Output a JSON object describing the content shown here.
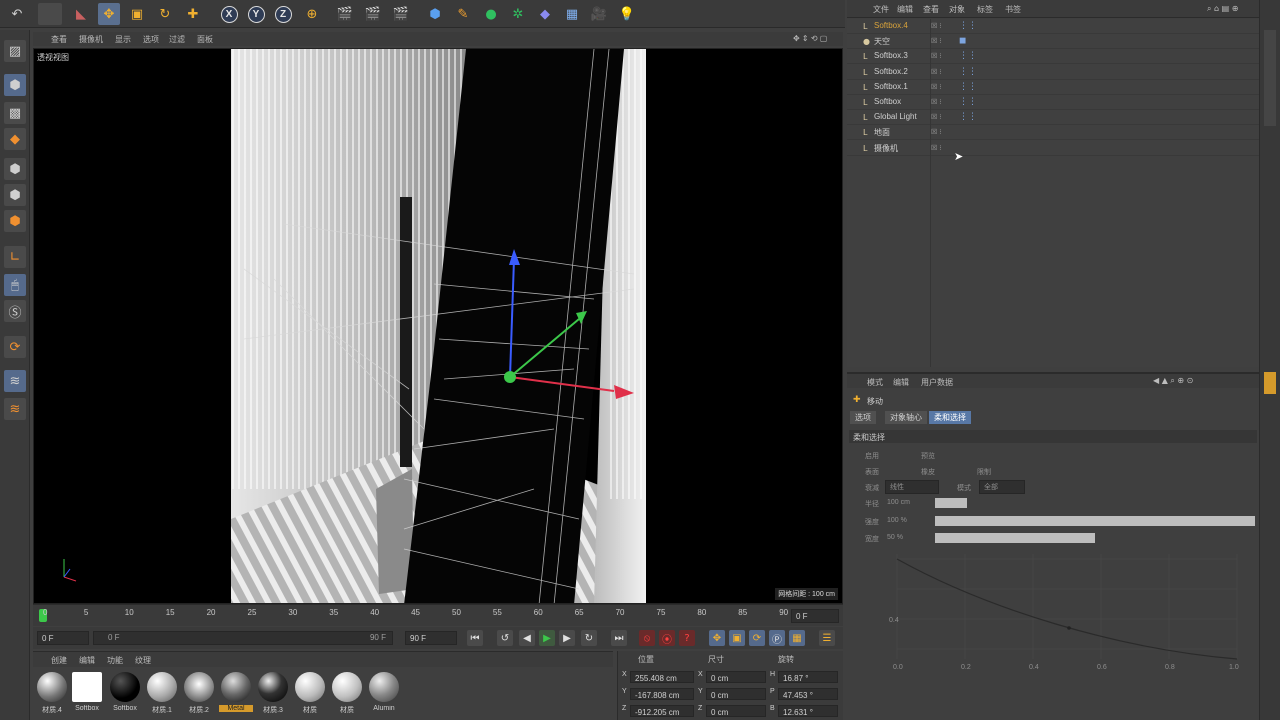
{
  "colors": {
    "accent": "#d9a33b",
    "selection": "#5878a6",
    "axis_x": "#e0304a",
    "axis_y": "#3cc84a",
    "axis_z": "#3a5cff"
  },
  "toolbar": {
    "undo_icon": "undo-icon",
    "x_label": "X",
    "y_label": "Y",
    "z_label": "Z"
  },
  "viewport": {
    "menu": [
      "查看",
      "摄像机",
      "显示",
      "选项",
      "过滤",
      "面板"
    ],
    "view_label": "透视视图",
    "grid_info": "网格间距 : 100 cm"
  },
  "timeline": {
    "ticks": [
      "0",
      "5",
      "10",
      "15",
      "20",
      "25",
      "30",
      "35",
      "40",
      "45",
      "50",
      "55",
      "60",
      "65",
      "70",
      "75",
      "80",
      "85",
      "90"
    ],
    "frame_readout": "0 F",
    "start_field": "0 F",
    "range_start": "0 F",
    "range_end": "90 F",
    "end_field": "90 F"
  },
  "materials": {
    "menu": [
      "创建",
      "编辑",
      "功能",
      "纹理"
    ],
    "items": [
      {
        "label": "材质.4",
        "highlight": false
      },
      {
        "label": "Softbox",
        "highlight": false
      },
      {
        "label": "Softbox",
        "highlight": false
      },
      {
        "label": "材质.1",
        "highlight": false
      },
      {
        "label": "材质.2",
        "highlight": false
      },
      {
        "label": "Metal",
        "highlight": true
      },
      {
        "label": "材质.3",
        "highlight": false
      },
      {
        "label": "材质",
        "highlight": false
      },
      {
        "label": "材质",
        "highlight": false
      },
      {
        "label": "Alumin",
        "highlight": false
      }
    ]
  },
  "coordinates": {
    "headers": [
      "位置",
      "尺寸",
      "旋转"
    ],
    "rows": [
      {
        "axis": "X",
        "pos": "255.408 cm",
        "size_axis": "X",
        "size": "0 cm",
        "rot_axis": "H",
        "rot": "16.87 °"
      },
      {
        "axis": "Y",
        "pos": "-167.808 cm",
        "size_axis": "Y",
        "size": "0 cm",
        "rot_axis": "P",
        "rot": "47.453 °"
      },
      {
        "axis": "Z",
        "pos": "-912.205 cm",
        "size_axis": "Z",
        "size": "0 cm",
        "rot_axis": "B",
        "rot": "12.631 °"
      }
    ]
  },
  "object_manager": {
    "menu": [
      "文件",
      "编辑",
      "查看",
      "对象",
      "标签",
      "书签"
    ],
    "objects": [
      {
        "name": "Softbox.4",
        "selected": true,
        "tag": "⋮⋮"
      },
      {
        "name": "天空",
        "selected": false,
        "tag": "◼"
      },
      {
        "name": "Softbox.3",
        "selected": false,
        "tag": "⋮⋮"
      },
      {
        "name": "Softbox.2",
        "selected": false,
        "tag": "⋮⋮"
      },
      {
        "name": "Softbox.1",
        "selected": false,
        "tag": "⋮⋮"
      },
      {
        "name": "Softbox",
        "selected": false,
        "tag": "⋮⋮"
      },
      {
        "name": "Global Light",
        "selected": false,
        "tag": "⋮⋮"
      },
      {
        "name": "地面",
        "selected": false,
        "tag": ""
      },
      {
        "name": "摄像机",
        "selected": false,
        "tag": ""
      }
    ]
  },
  "attribute_manager": {
    "menu": [
      "模式",
      "编辑",
      "用户数据"
    ],
    "tool_name": "移动",
    "tabs": [
      {
        "label": "选项",
        "active": false
      },
      {
        "label": "对象轴心",
        "active": false
      },
      {
        "label": "柔和选择",
        "active": true
      }
    ],
    "section": "柔和选择",
    "fields": [
      {
        "label": "半径",
        "value": "100 cm",
        "fraction": 0.1
      },
      {
        "label": "强度",
        "value": "100 %",
        "fraction": 1.0
      },
      {
        "label": "宽度",
        "value": "50 %",
        "fraction": 0.5
      }
    ],
    "options_row1": [
      "启用",
      "预览"
    ],
    "options_row2": [
      "表面",
      "橡皮",
      "限制"
    ],
    "mode_label": "衰减",
    "mode_value": "线性",
    "mode2_label": "模式",
    "mode2_value": "全部",
    "curve_x_ticks": [
      "0.0",
      "0.2",
      "0.4",
      "0.6",
      "0.8",
      "1.0"
    ],
    "curve_y_ticks": [
      "0.4"
    ]
  }
}
